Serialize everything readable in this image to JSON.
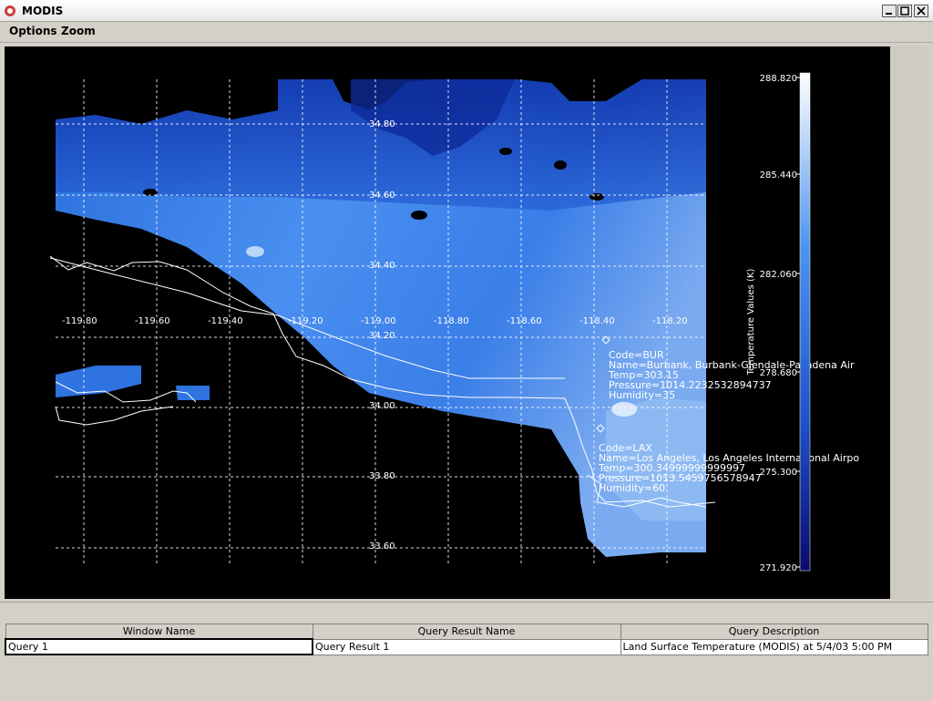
{
  "window": {
    "title": "MODIS"
  },
  "menu": {
    "options": "Options",
    "zoom": "Zoom"
  },
  "map": {
    "lat_labels": [
      "34.80",
      "34.60",
      "34.40",
      "34.20",
      "34.00",
      "33.80",
      "33.60"
    ],
    "lon_labels": [
      "-119.80",
      "-119.60",
      "-119.40",
      "-119.20",
      "-119.00",
      "-118.80",
      "-118.60",
      "-118.40",
      "-118.20"
    ],
    "stations": [
      {
        "lines": [
          "Code=BUR",
          "Name=Burbank, Burbank-Glendale-Pasadena Air",
          "Temp=303.15",
          "Pressure=1014.2232532894737",
          "Humidity=35"
        ]
      },
      {
        "lines": [
          "Code=LAX",
          "Name=Los Angeles, Los Angeles International Airpo",
          "Temp=300.34999999999997",
          "Pressure=1013.5459756578947",
          "Humidity=60"
        ]
      }
    ]
  },
  "colorbar": {
    "title": "Temperature Values (K)",
    "ticks": [
      "288.820",
      "285.440",
      "282.060",
      "278.680",
      "275.300",
      "271.920"
    ],
    "colors": {
      "top": "#ffffff",
      "mid": "#2f7bd6",
      "bottom": "#0a0a6a"
    }
  },
  "table": {
    "headers": [
      "Window Name",
      "Query Result Name",
      "Query Description"
    ],
    "rows": [
      [
        "Query 1",
        "Query Result 1",
        "Land Surface Temperature (MODIS) at 5/4/03 5:00 PM"
      ]
    ]
  }
}
